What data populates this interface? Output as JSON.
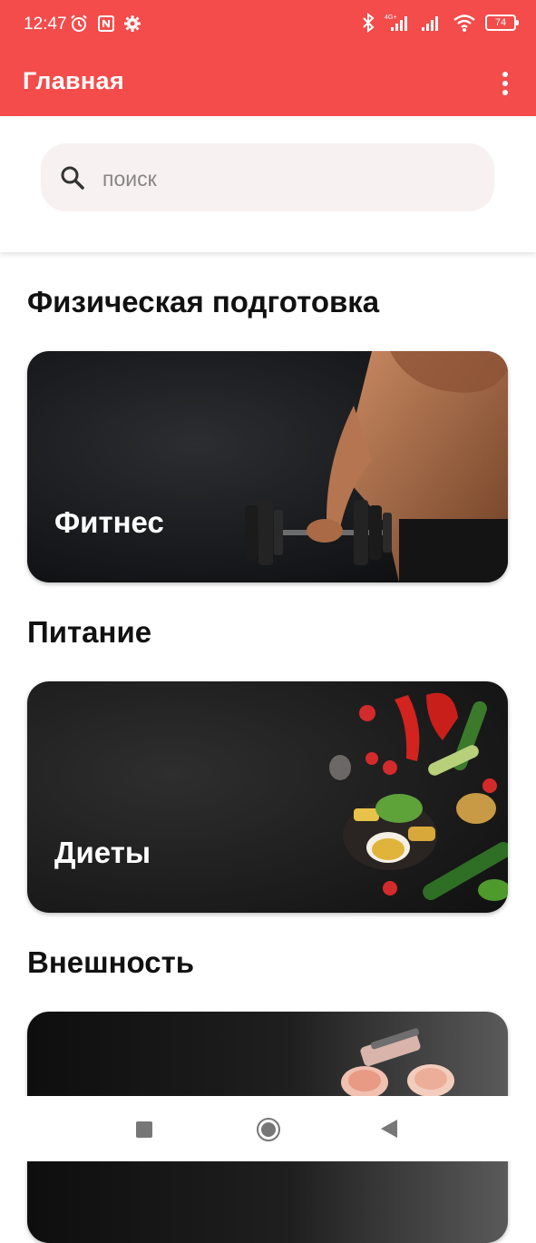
{
  "status_bar": {
    "time": "12:47",
    "battery": "74",
    "network": "4G+"
  },
  "app_bar": {
    "title": "Главная"
  },
  "search": {
    "placeholder": "поиск",
    "value": ""
  },
  "sections": [
    {
      "title": "Физическая подготовка",
      "card_label": "Фитнес"
    },
    {
      "title": "Питание",
      "card_label": "Диеты"
    },
    {
      "title": "Внешность",
      "card_label": ""
    }
  ],
  "colors": {
    "accent": "#f44b4b",
    "search_bg": "#f7f2f1"
  },
  "icons": [
    "alarm-icon",
    "nfc-icon",
    "settings-icon",
    "bluetooth-icon",
    "signal-icon",
    "wifi-icon",
    "battery-icon",
    "more-vert-icon",
    "search-icon",
    "square-icon",
    "circle-icon",
    "back-triangle-icon"
  ]
}
